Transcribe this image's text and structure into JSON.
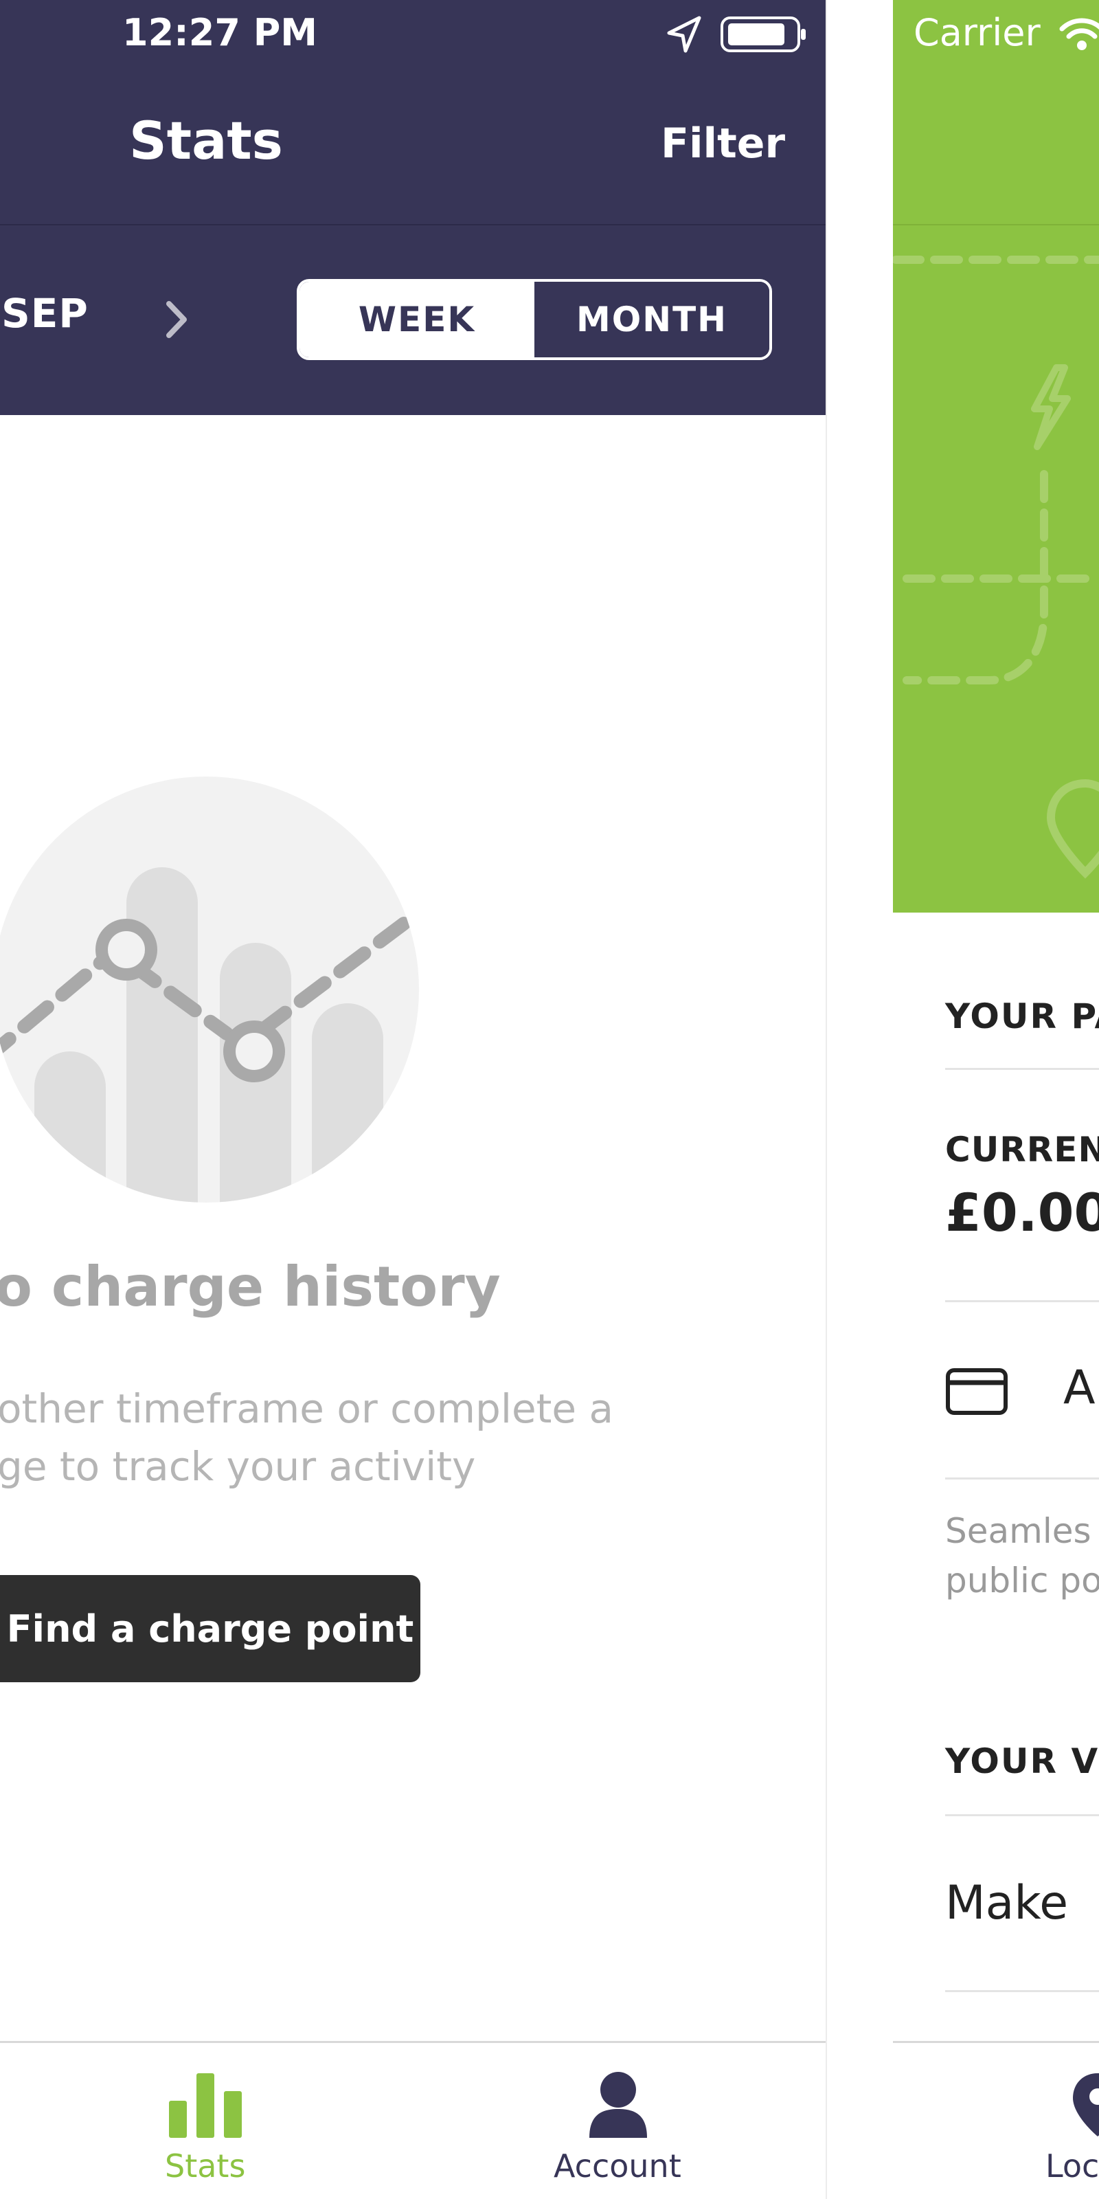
{
  "left": {
    "status_time": "12:27 PM",
    "title": "Stats",
    "filter_label": "Filter",
    "month_label": "SEP",
    "segments": {
      "week": "WEEK",
      "month": "MONTH"
    },
    "empty_title": "o charge history",
    "empty_line1": "other timeframe or complete a",
    "empty_line2": "ge to track your activity",
    "cta": "Find a charge point",
    "tabs": {
      "stats": "Stats",
      "account": "Account"
    }
  },
  "right": {
    "carrier": "Carrier",
    "section_payment": "YOUR PA",
    "currency_label": "CURREN",
    "amount": "£0.00",
    "card_row": "A",
    "seamless_line1": "Seamles",
    "seamless_line2": "public po",
    "section_vehicle": "YOUR VE",
    "make_row": "Make",
    "tab_partial": "Loc"
  },
  "colors": {
    "header_navy": "#373557",
    "accent_green": "#8cc342",
    "button_dark": "#2f2f2f"
  },
  "icons": [
    "location-arrow-icon",
    "battery-icon",
    "chevron-right-icon",
    "chart-illustration-icon",
    "bar-chart-icon",
    "account-icon",
    "wifi-icon",
    "credit-card-icon",
    "lightning-icon",
    "map-pin-icon"
  ]
}
